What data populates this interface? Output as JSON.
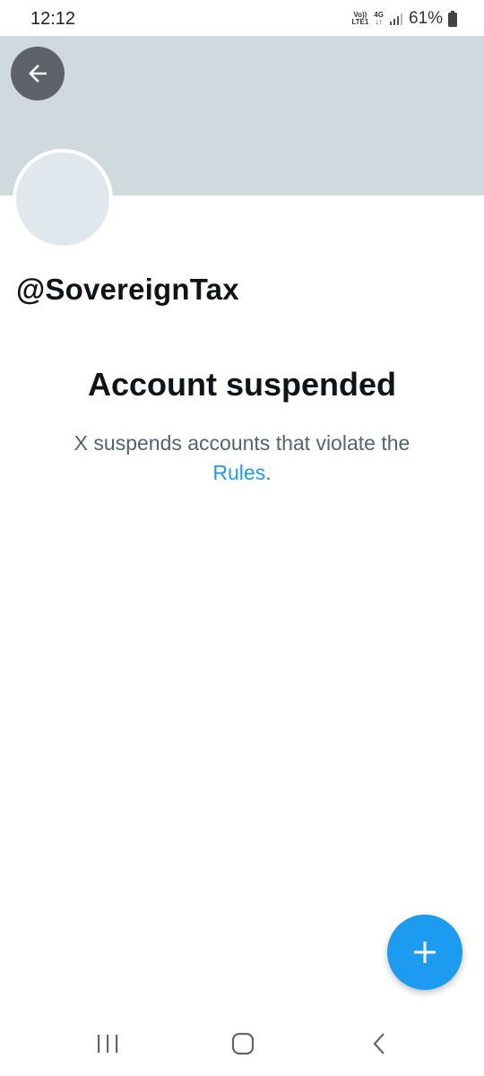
{
  "status_bar": {
    "time": "12:12",
    "volte_top": "Vo))",
    "volte_bottom": "LTE1",
    "network": "4G",
    "battery": "61%"
  },
  "profile": {
    "handle": "@SovereignTax",
    "banner_color": "#cfd9de"
  },
  "suspension": {
    "title": "Account suspended",
    "message": "X suspends accounts that violate the",
    "link_text": "Rules",
    "suffix": "."
  },
  "colors": {
    "accent": "#1d9bf0",
    "text_primary": "#0f1419",
    "text_secondary": "#536471"
  },
  "icons": {
    "back": "arrow-left-icon",
    "compose": "plus-icon",
    "recents": "recents-icon",
    "home": "home-icon",
    "back_nav": "chevron-left-icon"
  }
}
